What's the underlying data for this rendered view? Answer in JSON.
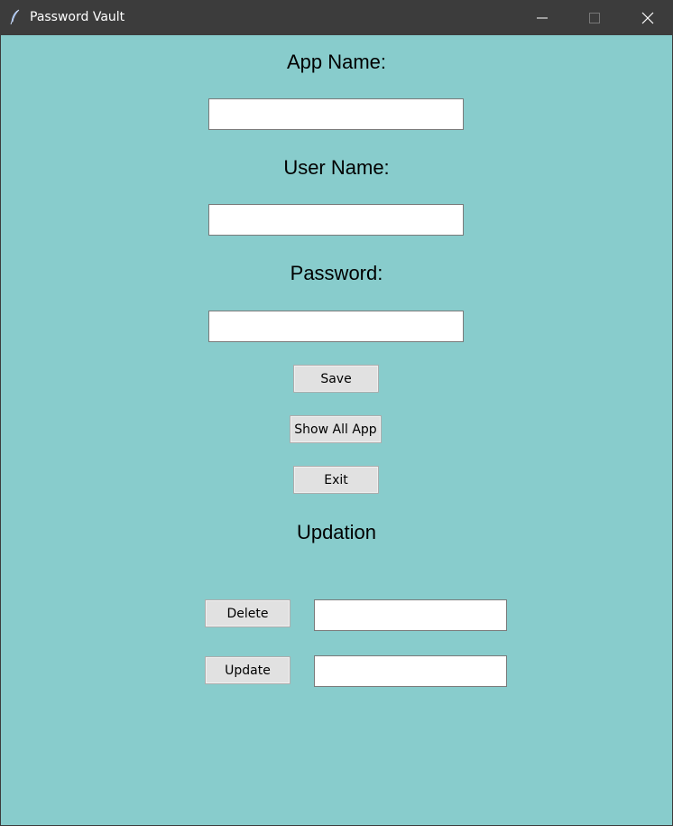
{
  "window": {
    "title": "Password Vault",
    "controls": {
      "minimize": "minimize-icon",
      "maximize": "maximize-icon",
      "close": "close-icon"
    },
    "colors": {
      "titlebar": "#3c3c3c",
      "background": "#88cccc",
      "button": "#e1e1e1"
    }
  },
  "form": {
    "app_name_label": "App Name:",
    "app_name_value": "",
    "user_name_label": "User Name:",
    "user_name_value": "",
    "password_label": "Password:",
    "password_value": ""
  },
  "actions": {
    "save": "Save",
    "show_all": "Show All App",
    "exit": "Exit"
  },
  "updation": {
    "heading": "Updation",
    "delete": "Delete",
    "delete_value": "",
    "update": "Update",
    "update_value": ""
  }
}
